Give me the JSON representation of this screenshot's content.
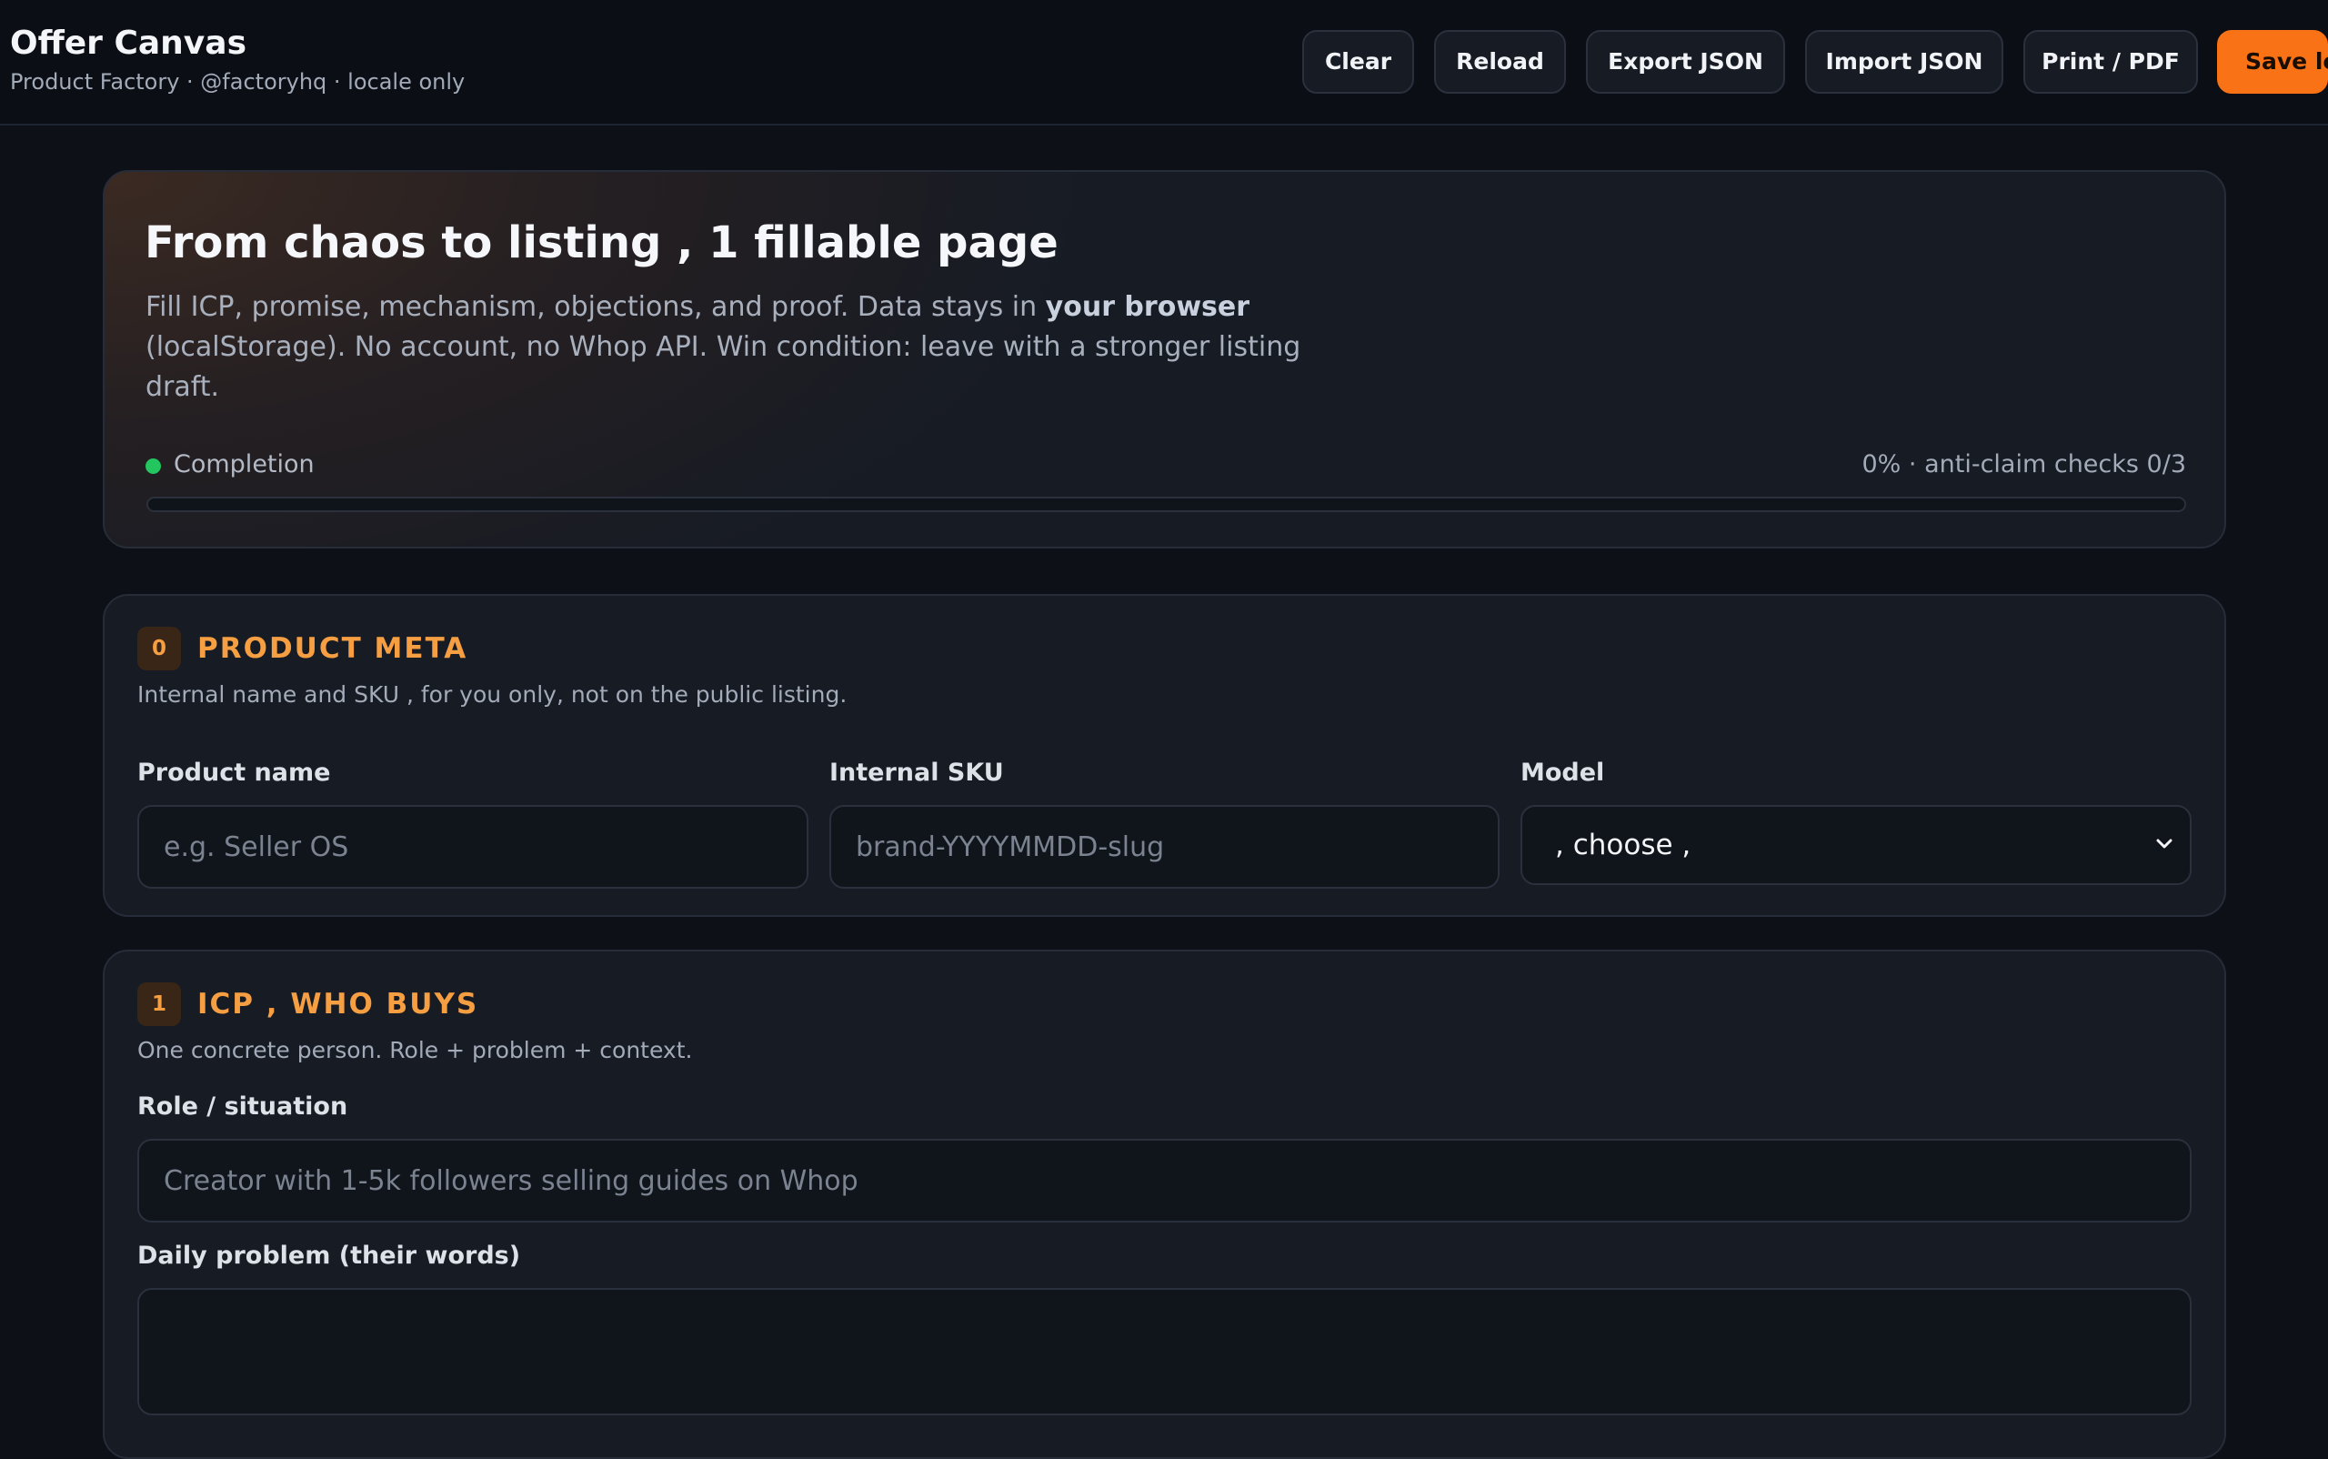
{
  "app": {
    "title": "Offer Canvas",
    "subtitle": "Product Factory · @factoryhq · locale only"
  },
  "toolbar": {
    "clear_label": "Clear",
    "reload_label": "Reload",
    "export_label": "Export JSON",
    "import_label": "Import JSON",
    "print_label": "Print / PDF",
    "save_label": "Save lo"
  },
  "hero": {
    "title": "From chaos to listing , 1 fillable page",
    "desc_before": "Fill ICP, promise, mechanism, objections, and proof. Data stays in ",
    "desc_bold": "your browser",
    "desc_after": " (localStorage). No account, no Whop API. Win condition: leave with a stronger listing draft.",
    "completion_label": "Completion",
    "completion_stat": "0% · anti-claim checks 0/3",
    "completion_percent": 0
  },
  "sections": {
    "meta": {
      "number": "0",
      "title": "PRODUCT META",
      "desc": "Internal name and SKU , for you only, not on the public listing.",
      "fields": {
        "product_name": {
          "label": "Product name",
          "placeholder": "e.g. Seller OS"
        },
        "sku": {
          "label": "Internal SKU",
          "placeholder": "brand-YYYYMMDD-slug"
        },
        "model": {
          "label": "Model",
          "value": ", choose ,"
        }
      }
    },
    "icp": {
      "number": "1",
      "title": "ICP , WHO BUYS",
      "desc": "One concrete person. Role + problem + context.",
      "fields": {
        "role": {
          "label": "Role / situation",
          "placeholder": "Creator with 1-5k followers selling guides on Whop"
        },
        "problem": {
          "label": "Daily problem (their words)"
        }
      }
    }
  },
  "colors": {
    "accent": "#f97316",
    "section_title": "#f59e42",
    "status_dot": "#22c55e",
    "background": "#0d1016",
    "card": "#161b24"
  },
  "icons": {
    "status": "green-dot-icon",
    "select": "chevron-down-icon"
  }
}
